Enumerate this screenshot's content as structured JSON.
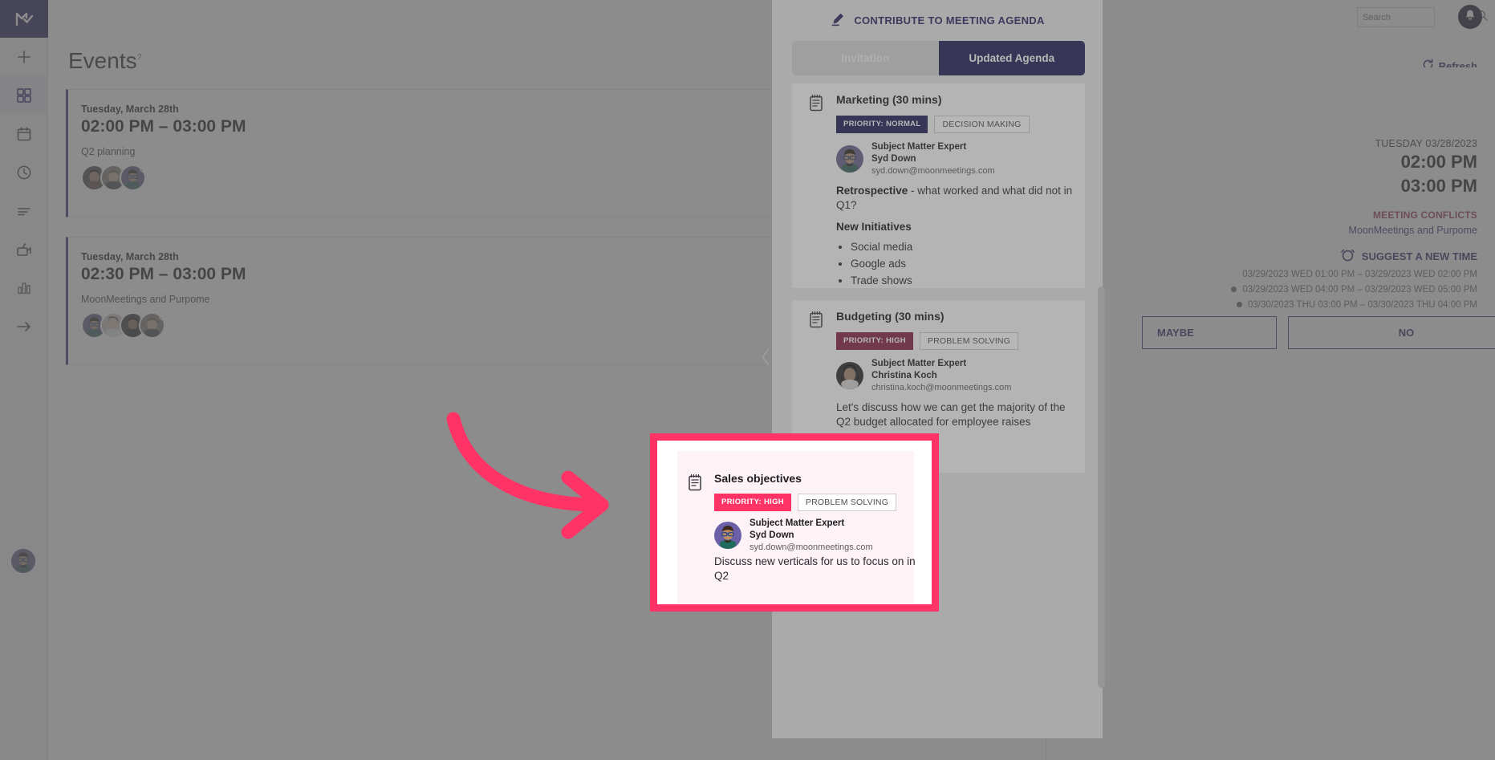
{
  "brand": {
    "accent": "#221c83",
    "pink": "#ff3366",
    "conflict_red": "#d9254e"
  },
  "topbar": {
    "search_placeholder": "Search",
    "search_value": "",
    "search_icon": "search-icon",
    "bell_icon": "bell-icon"
  },
  "sidebar": {
    "logo_icon": "moonmeetings-logo-icon",
    "items": [
      {
        "icon": "plus-icon",
        "name": "create"
      },
      {
        "icon": "grid-icon",
        "name": "events",
        "active": true
      },
      {
        "icon": "calendar-icon",
        "name": "calendar"
      },
      {
        "icon": "clock-icon",
        "name": "history"
      },
      {
        "icon": "list-icon",
        "name": "agenda-list"
      },
      {
        "icon": "video-icon",
        "name": "recordings"
      },
      {
        "icon": "bar-chart-icon",
        "name": "analytics"
      },
      {
        "icon": "arrow-right-icon",
        "name": "expand-rail"
      }
    ],
    "avatar": "user-avatar"
  },
  "page": {
    "title": "Events",
    "title_sup": "?",
    "refresh_label": "Refresh",
    "refresh_icon": "refresh-icon"
  },
  "events": [
    {
      "date": "Tuesday, March 28th",
      "time": "02:00 PM – 03:00 PM",
      "subject": "Q2 planning",
      "menu_icon": "more-options-icon",
      "attendees": [
        {
          "name": "attendee-1",
          "presence": "#9a9a9f",
          "hair": "#2b1d18",
          "skin": "#b4805c",
          "shirt": "#6f4a3d"
        },
        {
          "name": "attendee-2",
          "presence": "#1f9e63",
          "hair": "#7d6143",
          "skin": "#d3a682",
          "shirt": "#4a4f5a"
        },
        {
          "name": "attendee-3",
          "presence": "#9a9a9f",
          "hair": "#3a2a20",
          "skin": "#c08c62",
          "shirt": "#1f6b5e",
          "bg": "#6b5fa8"
        }
      ]
    },
    {
      "date": "Tuesday, March 28th",
      "time": "02:30 PM – 03:00 PM",
      "subject": "MoonMeetings and Purpome",
      "menu_icon": "more-options-icon",
      "attendees": [
        {
          "name": "attendee-1",
          "presence": "#1f9e63",
          "hair": "#3a2a20",
          "skin": "#c08c62",
          "shirt": "#1f6b5e",
          "bg": "#6b5fa8"
        },
        {
          "name": "attendee-2",
          "presence": "#9a9a9f",
          "hair": "#5b3a22",
          "skin": "#e2bb96",
          "shirt": "#e8e2dc"
        },
        {
          "name": "attendee-3",
          "presence": "#9a9a9f",
          "hair": "#241712",
          "skin": "#9c6c48",
          "shirt": "#2b2b33"
        },
        {
          "name": "attendee-4",
          "presence": "#9a9a9f",
          "hair": "#7d6143",
          "skin": "#d3a682",
          "shirt": "#4a4f5a"
        }
      ]
    }
  ],
  "detail": {
    "date": "TUESDAY 03/28/2023",
    "start_time": "02:00 PM",
    "end_time": "03:00 PM",
    "conflicts_label": "MEETING CONFLICTS",
    "conflicts_value": "MoonMeetings and Purpome",
    "suggest_label": "SUGGEST A NEW TIME",
    "suggest_icon": "alarm-clock-icon",
    "slots": [
      {
        "text": "03/29/2023 WED 01:00 PM – 03/29/2023 WED 02:00 PM",
        "dot": false
      },
      {
        "text": "03/29/2023 WED 04:00 PM – 03/29/2023 WED 05:00 PM",
        "dot": true
      },
      {
        "text": "03/30/2023 THU 03:00 PM – 03/30/2023 THU 04:00 PM",
        "dot": true
      }
    ],
    "maybe_label": "MAYBE",
    "no_label": "NO"
  },
  "agenda": {
    "contribute_label": "CONTRIBUTE TO MEETING AGENDA",
    "contribute_icon": "pencil-icon",
    "tabs": [
      {
        "label": "Invitation",
        "active": false
      },
      {
        "label": "Updated Agenda",
        "active": true
      }
    ],
    "items": [
      {
        "icon": "notepad-icon",
        "title": "Marketing (30 mins)",
        "priority_label": "PRIORITY: NORMAL",
        "priority_color": "#221c83",
        "type_label": "DECISION MAKING",
        "sme_role": "Subject Matter Expert",
        "sme_name": "Syd Down",
        "sme_email": "syd.down@moonmeetings.com",
        "body_lead": "Retrospective",
        "body_rest": " - what worked and what did not in Q1?",
        "body_sub": "New Initiatives",
        "bullets": [
          "Social media",
          "Google ads",
          "Trade shows"
        ]
      },
      {
        "icon": "notepad-icon",
        "title": "Budgeting (30 mins)",
        "priority_label": "PRIORITY: HIGH",
        "priority_color": "#c2134a",
        "type_label": "PROBLEM SOLVING",
        "sme_role": "Subject Matter Expert",
        "sme_name": "Christina Koch",
        "sme_email": "christina.koch@moonmeetings.com",
        "body_text": "Let's discuss how we can get the majority of the Q2 budget allocated for employee raises"
      }
    ],
    "highlighted_item": {
      "icon": "notepad-icon",
      "title": "Sales objectives",
      "priority_label": "PRIORITY: HIGH",
      "priority_color": "#ff3366",
      "type_label": "PROBLEM SOLVING",
      "sme_role": "Subject Matter Expert",
      "sme_name": "Syd Down",
      "sme_email": "syd.down@moonmeetings.com",
      "body_text": "Discuss new verticals for us to focus on in Q2"
    },
    "collapse_icon": "chevron-left-icon",
    "scrollbar": "vertical-scrollbar"
  },
  "annotation": {
    "arrow_icon": "curved-arrow-right-annotation",
    "color": "#ff3366"
  }
}
